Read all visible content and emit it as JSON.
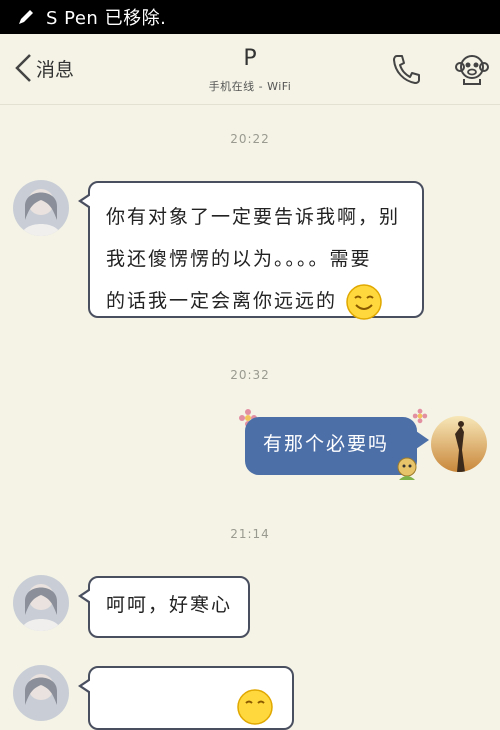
{
  "status_bar": {
    "text": "S Pen 已移除."
  },
  "header": {
    "back_label": "消息",
    "contact_name": "P",
    "contact_status": "手机在线 - WiFi"
  },
  "messages": [
    {
      "time": "20:22"
    },
    {
      "from": "left",
      "line1": "你有对象了一定要告诉我啊，别",
      "line2": "我还傻愣愣的以为。。。。需要",
      "line3": "的话我一定会离你远远的"
    },
    {
      "time": "20:32"
    },
    {
      "from": "right",
      "text": "有那个必要吗"
    },
    {
      "time": "21:14"
    },
    {
      "from": "left",
      "text": "呵呵，好寒心"
    }
  ],
  "colors": {
    "accent_bubble": "#4d6fa8",
    "background": "#f4f3e6",
    "bubble_border": "#4a4f60"
  }
}
